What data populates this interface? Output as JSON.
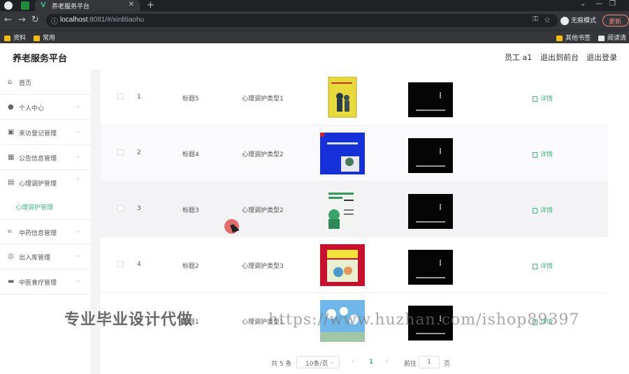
{
  "browser": {
    "tab_title": "养老服务平台",
    "url_host": "localhost",
    "url_rest": ":8081/#/xinlitiaohu",
    "incognito_label": "无痕模式",
    "update_label": "更新",
    "bookmarks": [
      "资料",
      "常用"
    ],
    "bookmarks_right": [
      "其他书签",
      "阅读清单"
    ]
  },
  "header": {
    "title": "养老服务平台",
    "user": "员工 a1",
    "back_front": "退出到前台",
    "logout": "退出登录"
  },
  "sidebar": {
    "items": [
      {
        "label": "首页",
        "icon": "home-icon"
      },
      {
        "label": "个人中心",
        "icon": "user-icon"
      },
      {
        "label": "来访登记管理",
        "icon": "register-icon"
      },
      {
        "label": "公告信息管理",
        "icon": "grid-icon"
      },
      {
        "label": "心理调护管理",
        "icon": "doc-icon"
      },
      {
        "label": "中药信息管理",
        "icon": "crop-icon"
      },
      {
        "label": "出入库管理",
        "icon": "globe-icon"
      },
      {
        "label": "中医食疗管理",
        "icon": "case-icon"
      }
    ],
    "submenu_label": "心理调护管理"
  },
  "table": {
    "detail_label": "详情",
    "rows": [
      {
        "no": "1",
        "title": "标题5",
        "type": "心理调护类型1"
      },
      {
        "no": "2",
        "title": "标题4",
        "type": "心理调护类型2"
      },
      {
        "no": "3",
        "title": "标题3",
        "type": "心理调护类型2"
      },
      {
        "no": "4",
        "title": "标题2",
        "type": "心理调护类型3"
      },
      {
        "no": "5",
        "title": "标题1",
        "type": "心理调护类型1"
      }
    ]
  },
  "pager": {
    "total": "共 5 条",
    "page_size": "10条/页",
    "current": "1",
    "goto": "前往",
    "goto_value": "1",
    "page_suffix": "页"
  },
  "watermark": {
    "left": "专业毕业设计代做",
    "right": "https://www.huzhan.com/ishop89397"
  },
  "colors": {
    "accent": "#41b883",
    "browser_bg": "#202124"
  }
}
